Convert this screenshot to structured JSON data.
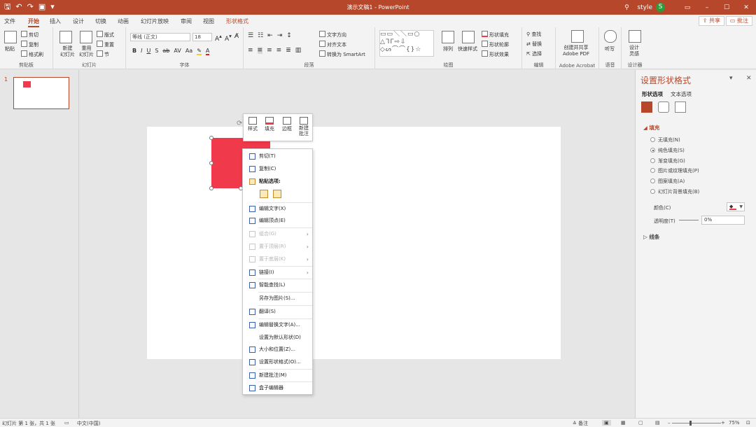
{
  "app": {
    "window_title": "演示文稿1 - PowerPoint",
    "user": "style",
    "user_initial": "S",
    "accent_color": "#b7472a",
    "shape_color": "#f0394a"
  },
  "titlebar": {
    "qat_icons": [
      "save-icon",
      "undo-icon",
      "redo-icon",
      "present-icon",
      "customize-icon"
    ],
    "buttons": [
      "ribbon-display-icon",
      "minimize-icon",
      "restore-icon",
      "close-icon"
    ]
  },
  "tabs": [
    "文件",
    "开始",
    "插入",
    "设计",
    "切换",
    "动画",
    "幻灯片放映",
    "审阅",
    "视图",
    "形状格式"
  ],
  "share_label": "共享",
  "comment_label": "批注",
  "ribbon": {
    "clipboard": {
      "paste": "粘贴",
      "cut": "剪切",
      "copy": "复制",
      "format_painter": "格式刷",
      "label": "剪贴板"
    },
    "slides": {
      "new_slide": "新建\n幻灯片",
      "reuse": "重用\n幻灯片",
      "layout": "版式",
      "reset": "重置",
      "section": "节",
      "label": "幻灯片"
    },
    "font": {
      "name": "等线 (正文)",
      "size": "18",
      "label": "字体",
      "buttons": [
        "B",
        "I",
        "U",
        "S",
        "ab",
        "AV",
        "Aa"
      ]
    },
    "paragraph": {
      "text_direction": "文字方向",
      "align_text": "对齐文本",
      "smartart": "转换为 SmartArt",
      "label": "段落"
    },
    "drawing": {
      "arrange": "排列",
      "quick_styles": "快速样式",
      "shape_fill": "形状填充",
      "shape_outline": "形状轮廓",
      "shape_effects": "形状效果",
      "label": "绘图"
    },
    "editing": {
      "find": "查找",
      "replace": "替换",
      "select": "选择",
      "label": "编辑"
    },
    "acrobat": {
      "create": "创建并共享\nAdobe PDF",
      "label": "Adobe Acrobat"
    },
    "voice": {
      "dictate": "听写",
      "label": "语音"
    },
    "designer": {
      "ideas": "设计\n灵感",
      "label": "设计器"
    }
  },
  "thumbnail": {
    "number": "1"
  },
  "minibar": {
    "style": "样式",
    "fill": "填充",
    "outline": "边框",
    "new_comment_line1": "新建",
    "new_comment_line2": "批注"
  },
  "context_menu": {
    "cut": "剪切(T)",
    "copy": "复制(C)",
    "paste_options": "粘贴选项:",
    "edit_text": "编辑文字(X)",
    "edit_points": "编辑顶点(E)",
    "group": "组合(G)",
    "bring_front": "置于顶层(R)",
    "send_back": "置于底层(K)",
    "link": "链接(I)",
    "smart_lookup": "智能查找(L)",
    "save_as_picture": "另存为图片(S)...",
    "translate": "翻译(S)",
    "alt_text": "编辑替换文字(A)...",
    "set_default": "设置为默认形状(D)",
    "size_position": "大小和位置(Z)...",
    "format_shape": "设置形状格式(O)...",
    "new_comment": "新建批注(M)",
    "box_editor": "盒子编辑器"
  },
  "format_pane": {
    "title": "设置形状格式",
    "tab_shape": "形状选项",
    "tab_text": "文本选项",
    "fill_section": "填充",
    "fill_options": [
      "无填充(N)",
      "纯色填充(S)",
      "渐变填充(G)",
      "图片或纹理填充(P)",
      "图案填充(A)",
      "幻灯片背景填充(B)"
    ],
    "selected_fill_index": 1,
    "color_label": "颜色(C)",
    "transparency_label": "透明度(T)",
    "transparency_value": "0%",
    "line_section": "线条"
  },
  "statusbar": {
    "slide_info": "幻灯片 第 1 张，共 1 张",
    "language": "中文(中国)",
    "notes": "备注",
    "zoom": "75%"
  }
}
